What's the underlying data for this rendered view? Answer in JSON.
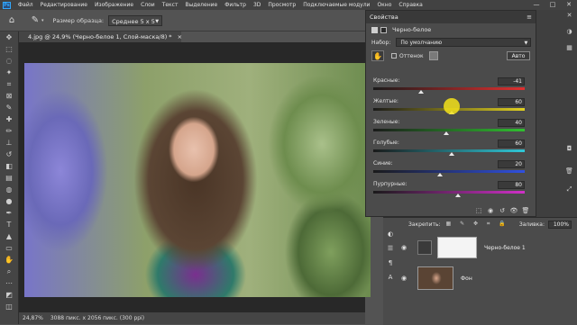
{
  "app": {
    "logo": "Ps"
  },
  "menu": [
    "Файл",
    "Редактирование",
    "Изображение",
    "Слои",
    "Текст",
    "Выделение",
    "Фильтр",
    "3D",
    "Просмотр",
    "Подключаемые модули",
    "Окно",
    "Справка"
  ],
  "window_controls": {
    "minimize": "—",
    "maximize": "□",
    "close": "✕"
  },
  "options_bar": {
    "home_icon": "home-icon",
    "tool_icon": "eyedropper-icon",
    "sample_label": "Размер образца:",
    "sample_value": "Среднее 5 х 5"
  },
  "document": {
    "tab_title": "4.jpg @ 24,9% (Черно-белое 1, Слой-маска/8) *",
    "close": "×"
  },
  "status": {
    "zoom": "24,87%",
    "info": "3088 пикс. x 2056 пикс. (300 ppi)"
  },
  "properties": {
    "title": "Свойства",
    "menu_icon": "≡",
    "subtitle": "Черно-белое",
    "preset_label": "Набор:",
    "preset_value": "По умолчанию",
    "tint_label": "Оттенок",
    "auto_label": "Авто",
    "sliders": [
      {
        "label": "Красные:",
        "value": "-41",
        "num": -41
      },
      {
        "label": "Желтые:",
        "value": "60",
        "num": 60
      },
      {
        "label": "Зеленые:",
        "value": "40",
        "num": 40
      },
      {
        "label": "Голубые:",
        "value": "60",
        "num": 60
      },
      {
        "label": "Синие:",
        "value": "20",
        "num": 20
      },
      {
        "label": "Пурпурные:",
        "value": "80",
        "num": 80
      }
    ],
    "slider_min": -200,
    "slider_max": 300
  },
  "layers": {
    "lock_label": "Закрепить:",
    "lock_icons": "▦ ✎ ✥ ⌗ 🔒",
    "fill_label": "Заливка:",
    "fill_value": "100%",
    "items": [
      {
        "name": "Черно-белое 1",
        "visible_icon": "◉"
      },
      {
        "name": "Фон",
        "visible_icon": "◉"
      }
    ]
  },
  "colors": {
    "accent": "#31a8ff",
    "highlight": "#f3e21a"
  }
}
